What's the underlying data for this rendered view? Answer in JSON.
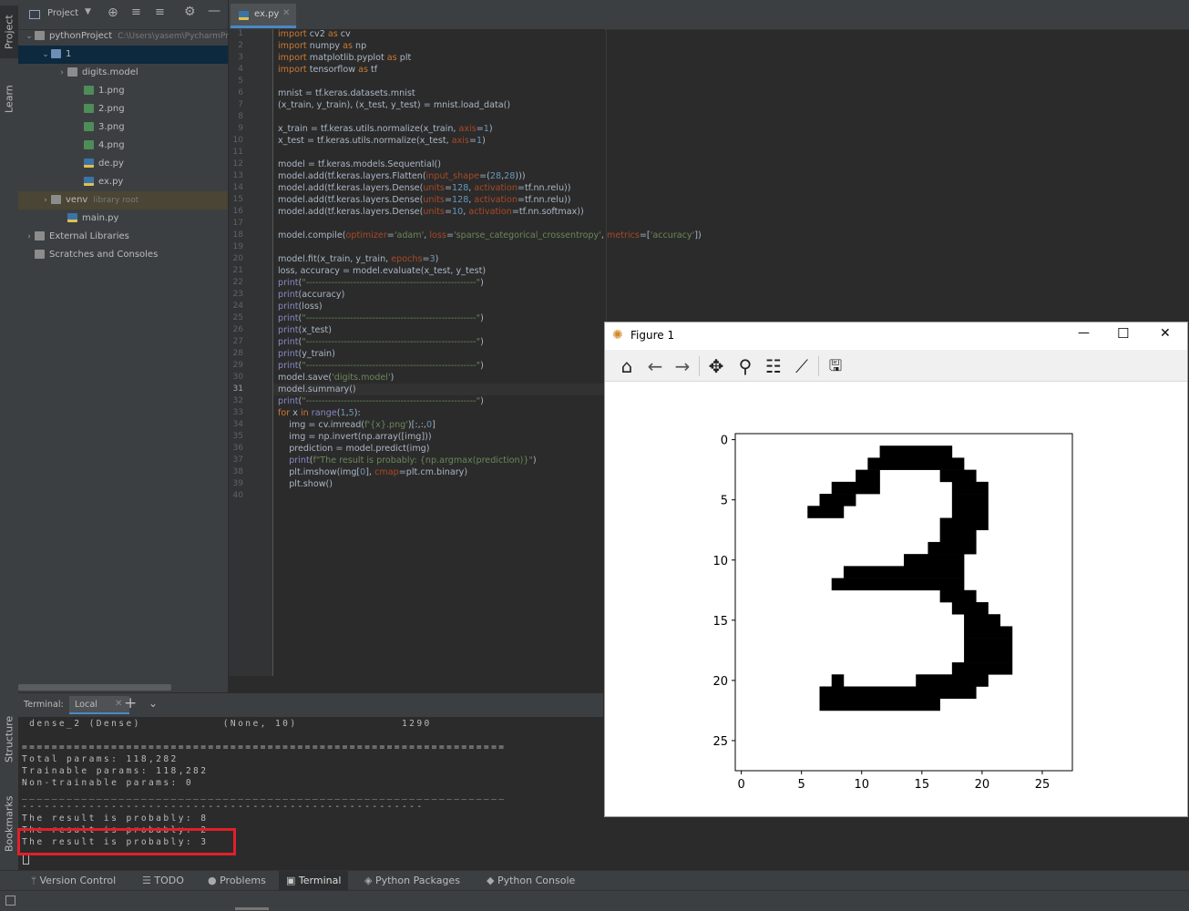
{
  "sidebar": {
    "tabs": {
      "project": "Project",
      "learn": "Learn",
      "structure": "Structure",
      "bookmarks": "Bookmarks"
    }
  },
  "project_panel": {
    "dropdown_label": "Project",
    "tree": [
      {
        "label": "pythonProject",
        "hint": "C:\\Users\\yasem\\PycharmProj",
        "type": "folder",
        "expanded": true
      },
      {
        "label": "1",
        "type": "folder",
        "expanded": true,
        "selected": true
      },
      {
        "label": "digits.model",
        "type": "folder",
        "expanded": false
      },
      {
        "label": "1.png",
        "type": "png"
      },
      {
        "label": "2.png",
        "type": "png"
      },
      {
        "label": "3.png",
        "type": "png"
      },
      {
        "label": "4.png",
        "type": "png"
      },
      {
        "label": "de.py",
        "type": "py"
      },
      {
        "label": "ex.py",
        "type": "py"
      },
      {
        "label": "venv",
        "hint": "library root",
        "type": "folder",
        "expanded": false
      },
      {
        "label": "main.py",
        "type": "py"
      },
      {
        "label": "External Libraries",
        "type": "lib",
        "expanded": false
      },
      {
        "label": "Scratches and Consoles",
        "type": "scratch"
      }
    ]
  },
  "editor": {
    "tab_label": "ex.py",
    "current_line": 31,
    "line_numbers": [
      "1",
      "2",
      "3",
      "4",
      "5",
      "6",
      "7",
      "8",
      "9",
      "10",
      "11",
      "12",
      "13",
      "14",
      "15",
      "16",
      "17",
      "18",
      "19",
      "20",
      "21",
      "22",
      "23",
      "24",
      "25",
      "26",
      "27",
      "28",
      "29",
      "30",
      "31",
      "32",
      "33",
      "34",
      "35",
      "36",
      "37",
      "38",
      "39",
      "40"
    ]
  },
  "code_lines": [
    [
      [
        "kw",
        "import"
      ],
      [
        "t",
        " cv2 "
      ],
      [
        "kw",
        "as"
      ],
      [
        "t",
        " cv"
      ]
    ],
    [
      [
        "kw",
        "import"
      ],
      [
        "t",
        " numpy "
      ],
      [
        "kw",
        "as"
      ],
      [
        "t",
        " np"
      ]
    ],
    [
      [
        "kw",
        "import"
      ],
      [
        "t",
        " matplotlib.pyplot "
      ],
      [
        "kw",
        "as"
      ],
      [
        "t",
        " plt"
      ]
    ],
    [
      [
        "kw",
        "import"
      ],
      [
        "t",
        " tensorflow "
      ],
      [
        "kw",
        "as"
      ],
      [
        "t",
        " tf"
      ]
    ],
    [],
    [
      [
        "t",
        "mnist = tf.keras.datasets.mnist"
      ]
    ],
    [
      [
        "t",
        "(x_train, y_train), (x_test, y_test) = mnist.load_data()"
      ]
    ],
    [],
    [
      [
        "t",
        "x_train = tf.keras.utils.normalize(x_train, "
      ],
      [
        "prm",
        "axis"
      ],
      [
        "t",
        "="
      ],
      [
        "num",
        "1"
      ],
      [
        "t",
        ")"
      ]
    ],
    [
      [
        "t",
        "x_test = tf.keras.utils.normalize(x_test, "
      ],
      [
        "prm",
        "axis"
      ],
      [
        "t",
        "="
      ],
      [
        "num",
        "1"
      ],
      [
        "t",
        ")"
      ]
    ],
    [],
    [
      [
        "t",
        "model = tf.keras.models.Sequential()"
      ]
    ],
    [
      [
        "t",
        "model.add(tf.keras.layers.Flatten("
      ],
      [
        "prm",
        "input_shape"
      ],
      [
        "t",
        "=("
      ],
      [
        "num",
        "28"
      ],
      [
        "t",
        ","
      ],
      [
        "num",
        "28"
      ],
      [
        "t",
        ")))"
      ]
    ],
    [
      [
        "t",
        "model.add(tf.keras.layers.Dense("
      ],
      [
        "prm",
        "units"
      ],
      [
        "t",
        "="
      ],
      [
        "num",
        "128"
      ],
      [
        "t",
        ", "
      ],
      [
        "prm",
        "activation"
      ],
      [
        "t",
        "=tf.nn.relu))"
      ]
    ],
    [
      [
        "t",
        "model.add(tf.keras.layers.Dense("
      ],
      [
        "prm",
        "units"
      ],
      [
        "t",
        "="
      ],
      [
        "num",
        "128"
      ],
      [
        "t",
        ", "
      ],
      [
        "prm",
        "activation"
      ],
      [
        "t",
        "=tf.nn.relu))"
      ]
    ],
    [
      [
        "t",
        "model.add(tf.keras.layers.Dense("
      ],
      [
        "prm",
        "units"
      ],
      [
        "t",
        "="
      ],
      [
        "num",
        "10"
      ],
      [
        "t",
        ", "
      ],
      [
        "prm",
        "activation"
      ],
      [
        "t",
        "=tf.nn.softmax))"
      ]
    ],
    [],
    [
      [
        "t",
        "model.compile("
      ],
      [
        "prm",
        "optimizer"
      ],
      [
        "t",
        "="
      ],
      [
        "str",
        "'adam'"
      ],
      [
        "t",
        ", "
      ],
      [
        "prm",
        "loss"
      ],
      [
        "t",
        "="
      ],
      [
        "str",
        "'sparse_categorical_crossentropy'"
      ],
      [
        "t",
        ", "
      ],
      [
        "prm",
        "metrics"
      ],
      [
        "t",
        "=["
      ],
      [
        "str",
        "'accuracy'"
      ],
      [
        "t",
        "])"
      ]
    ],
    [],
    [
      [
        "t",
        "model.fit(x_train, y_train, "
      ],
      [
        "prm",
        "epochs"
      ],
      [
        "t",
        "="
      ],
      [
        "num",
        "3"
      ],
      [
        "t",
        ")"
      ]
    ],
    [
      [
        "t",
        "loss, accuracy = model.evaluate(x_test, y_test)"
      ]
    ],
    [
      [
        "fnc",
        "print"
      ],
      [
        "t",
        "("
      ],
      [
        "str",
        "\"------------------------------------------------------\""
      ],
      [
        "t",
        ")"
      ]
    ],
    [
      [
        "fnc",
        "print"
      ],
      [
        "t",
        "(accuracy)"
      ]
    ],
    [
      [
        "fnc",
        "print"
      ],
      [
        "t",
        "(loss)"
      ]
    ],
    [
      [
        "fnc",
        "print"
      ],
      [
        "t",
        "("
      ],
      [
        "str",
        "\"------------------------------------------------------\""
      ],
      [
        "t",
        ")"
      ]
    ],
    [
      [
        "fnc",
        "print"
      ],
      [
        "t",
        "(x_test)"
      ]
    ],
    [
      [
        "fnc",
        "print"
      ],
      [
        "t",
        "("
      ],
      [
        "str",
        "\"------------------------------------------------------\""
      ],
      [
        "t",
        ")"
      ]
    ],
    [
      [
        "fnc",
        "print"
      ],
      [
        "t",
        "(y_train)"
      ]
    ],
    [
      [
        "fnc",
        "print"
      ],
      [
        "t",
        "("
      ],
      [
        "str",
        "\"------------------------------------------------------\""
      ],
      [
        "t",
        ")"
      ]
    ],
    [
      [
        "t",
        "model.save("
      ],
      [
        "str",
        "'digits.model'"
      ],
      [
        "t",
        ")"
      ]
    ],
    [
      [
        "t",
        "model.summary()"
      ]
    ],
    [
      [
        "fnc",
        "print"
      ],
      [
        "t",
        "("
      ],
      [
        "str",
        "\"------------------------------------------------------\""
      ],
      [
        "t",
        ")"
      ]
    ],
    [
      [
        "kw",
        "for"
      ],
      [
        "t",
        " x "
      ],
      [
        "kw",
        "in"
      ],
      [
        "t",
        " "
      ],
      [
        "fnc",
        "range"
      ],
      [
        "t",
        "("
      ],
      [
        "num",
        "1"
      ],
      [
        "t",
        ","
      ],
      [
        "num",
        "5"
      ],
      [
        "t",
        "):"
      ]
    ],
    [
      [
        "t",
        "    img = cv.imread("
      ],
      [
        "str",
        "f'{x}.png'"
      ],
      [
        "t",
        ")[:,:,"
      ],
      [
        "num",
        "0"
      ],
      [
        "t",
        "]"
      ]
    ],
    [
      [
        "t",
        "    img = np.invert(np.array([img]))"
      ]
    ],
    [
      [
        "t",
        "    prediction = model.predict(img)"
      ]
    ],
    [
      [
        "t",
        "    "
      ],
      [
        "fnc",
        "print"
      ],
      [
        "t",
        "("
      ],
      [
        "str",
        "f\"The result is probably: {np.argmax(prediction)}\""
      ],
      [
        "t",
        ")"
      ]
    ],
    [
      [
        "t",
        "    plt.imshow(img["
      ],
      [
        "num",
        "0"
      ],
      [
        "t",
        "], "
      ],
      [
        "prm",
        "cmap"
      ],
      [
        "t",
        "=plt.cm.binary)"
      ]
    ],
    [
      [
        "t",
        "    plt.show()"
      ]
    ],
    []
  ],
  "terminal": {
    "title": "Terminal:",
    "tab": "Local",
    "lines": [
      " dense_2 (Dense)           (None, 10)              1290",
      "",
      "=================================================================",
      "Total params: 118,282",
      "Trainable params: 118,282",
      "Non-trainable params: 0",
      "_________________________________________________________________",
      "------------------------------------------------------",
      "The result is probably: 8",
      "The result is probably: 2",
      "The result is probably: 3"
    ]
  },
  "bottom_tabs": {
    "version_control": "Version Control",
    "todo": "TODO",
    "problems": "Problems",
    "terminal": "Terminal",
    "python_packages": "Python Packages",
    "python_console": "Python Console"
  },
  "figure": {
    "title": "Figure 1",
    "toolbar": [
      "home-icon",
      "back-icon",
      "forward-icon",
      "pan-icon",
      "zoom-icon",
      "configure-subplots-icon",
      "edit-axis-icon",
      "save-icon"
    ],
    "window_buttons": {
      "minimize": "—",
      "maximize": "☐",
      "close": "✕"
    }
  },
  "chart_data": {
    "type": "heatmap",
    "colormap": "binary",
    "x_ticks": [
      0,
      5,
      10,
      15,
      20,
      25
    ],
    "y_ticks": [
      0,
      5,
      10,
      15,
      20,
      25
    ],
    "xlim": [
      -0.5,
      27.5
    ],
    "ylim": [
      27.5,
      -0.5
    ],
    "grid": false,
    "black_pixel_runs": [
      [
        1,
        [
          12,
          17
        ]
      ],
      [
        2,
        [
          11,
          18
        ]
      ],
      [
        3,
        [
          10,
          11
        ],
        [
          17,
          19
        ]
      ],
      [
        4,
        [
          8,
          11
        ],
        [
          18,
          20
        ]
      ],
      [
        5,
        [
          7,
          9
        ],
        [
          18,
          20
        ]
      ],
      [
        6,
        [
          6,
          8
        ],
        [
          18,
          20
        ]
      ],
      [
        7,
        [
          17,
          20
        ]
      ],
      [
        8,
        [
          17,
          19
        ]
      ],
      [
        9,
        [
          16,
          19
        ]
      ],
      [
        10,
        [
          14,
          18
        ]
      ],
      [
        11,
        [
          9,
          18
        ]
      ],
      [
        12,
        [
          8,
          18
        ]
      ],
      [
        13,
        [
          17,
          19
        ]
      ],
      [
        14,
        [
          18,
          20
        ]
      ],
      [
        15,
        [
          19,
          21
        ]
      ],
      [
        16,
        [
          19,
          22
        ]
      ],
      [
        17,
        [
          19,
          22
        ]
      ],
      [
        18,
        [
          19,
          22
        ]
      ],
      [
        19,
        [
          18,
          22
        ]
      ],
      [
        20,
        [
          8,
          8
        ],
        [
          15,
          20
        ]
      ],
      [
        21,
        [
          7,
          19
        ]
      ],
      [
        22,
        [
          7,
          16
        ]
      ]
    ]
  }
}
